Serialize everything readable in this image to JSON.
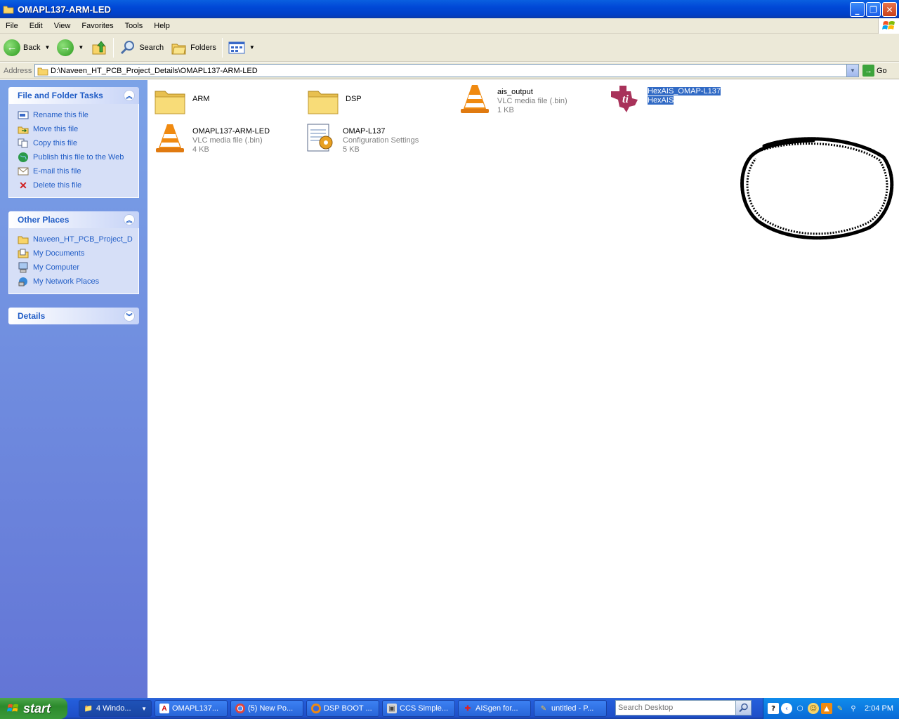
{
  "window": {
    "title": "OMAPL137-ARM-LED"
  },
  "menubar": {
    "items": [
      "File",
      "Edit",
      "View",
      "Favorites",
      "Tools",
      "Help"
    ]
  },
  "toolbar": {
    "back_label": "Back",
    "search_label": "Search",
    "folders_label": "Folders"
  },
  "address": {
    "label": "Address",
    "value": "D:\\Naveen_HT_PCB_Project_Details\\OMAPL137-ARM-LED",
    "go_label": "Go"
  },
  "tasks": {
    "file_folder": {
      "title": "File and Folder Tasks",
      "items": [
        "Rename this file",
        "Move this file",
        "Copy this file",
        "Publish this file to the Web",
        "E-mail this file",
        "Delete this file"
      ]
    },
    "other_places": {
      "title": "Other Places",
      "items": [
        "Naveen_HT_PCB_Project_D",
        "My Documents",
        "My Computer",
        "My Network Places"
      ]
    },
    "details": {
      "title": "Details"
    }
  },
  "files": [
    {
      "name": "ARM",
      "type": "",
      "size": "",
      "icon": "folder-icon"
    },
    {
      "name": "DSP",
      "type": "",
      "size": "",
      "icon": "folder-icon"
    },
    {
      "name": "ais_output",
      "type": "VLC media file (.bin)",
      "size": "1 KB",
      "icon": "vlc-cone-icon"
    },
    {
      "name": "HexAIS_OMAP-L137",
      "type": "HexAIS",
      "size": "",
      "icon": "ti-logo-icon",
      "selected": true
    },
    {
      "name": "OMAPL137-ARM-LED",
      "type": "VLC media file (.bin)",
      "size": "4 KB",
      "icon": "vlc-cone-icon"
    },
    {
      "name": "OMAP-L137",
      "type": "Configuration Settings",
      "size": "5 KB",
      "icon": "config-settings-icon"
    }
  ],
  "taskbar": {
    "start_label": "start",
    "buttons": [
      "4 Windo...",
      "OMAPL137...",
      "(5) New Po...",
      "DSP BOOT ...",
      "CCS Simple...",
      "AISgen for...",
      "untitled - P..."
    ],
    "search_placeholder": "Search Desktop",
    "clock": "2:04 PM"
  },
  "colors": {
    "titlebar": "#0048d6",
    "panel_link": "#215dc6",
    "selection": "#316ac5",
    "ti_red": "#a8325a"
  }
}
